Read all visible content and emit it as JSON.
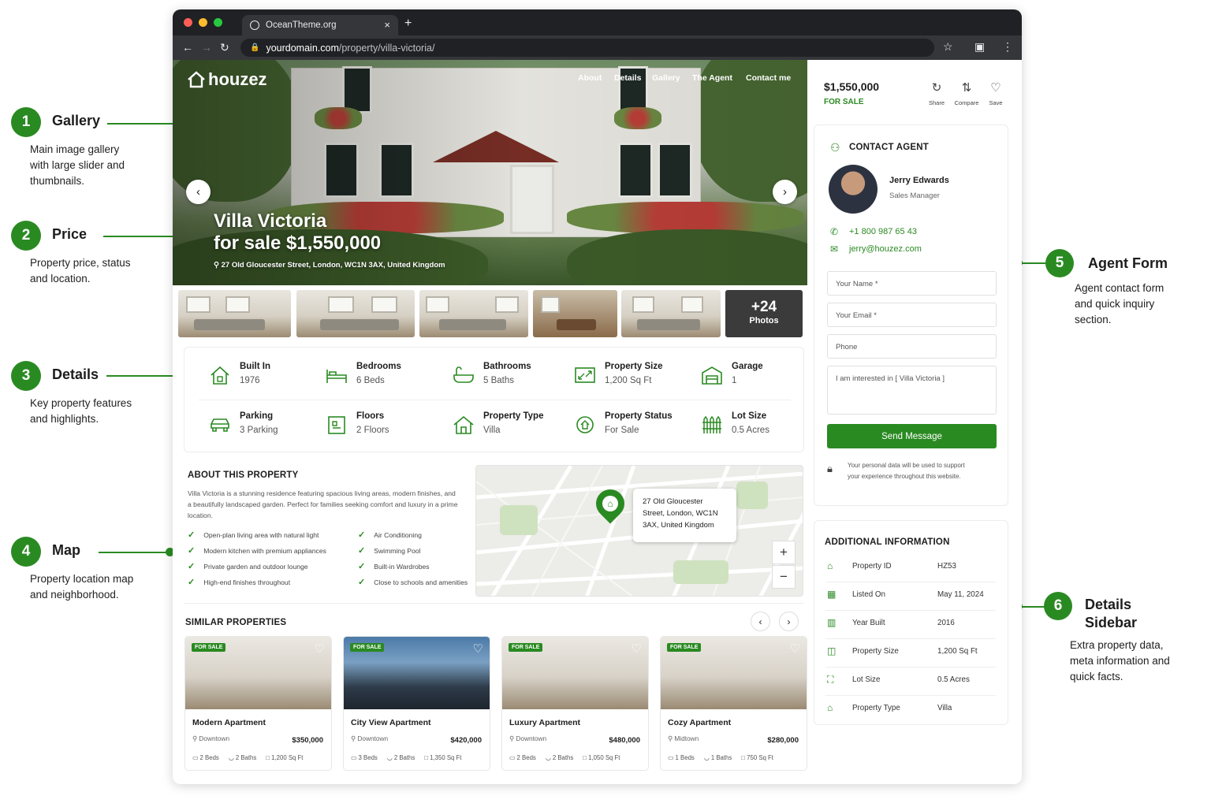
{
  "annotations": [
    {
      "num": "1",
      "title": "Gallery",
      "desc": "Main image gallery with large slider and thumbnails."
    },
    {
      "num": "2",
      "title": "Price",
      "desc": "Property price, status and location."
    },
    {
      "num": "3",
      "title": "Details",
      "desc": "Key property features and highlights."
    },
    {
      "num": "4",
      "title": "Map",
      "desc": "Property location map and neighborhood."
    },
    {
      "num": "5",
      "title": "Agent Form",
      "desc": "Agent contact form and quick inquiry section."
    },
    {
      "num": "6",
      "title": "Details Sidebar",
      "desc": "Extra property data, meta information and quick facts."
    }
  ],
  "browser": {
    "tab_title": "OceanTheme.org",
    "url_domain": "yourdomain.com",
    "url_path": "/property/villa-victoria/"
  },
  "site": {
    "logo": "houzez",
    "menu": [
      "About",
      "Details",
      "Gallery",
      "The Agent",
      "Contact me"
    ],
    "hero_title_line1": "Villa Victoria",
    "hero_title_line2": "for sale $1,550,000",
    "hero_address": "27 Old Gloucester Street, London, WC1N 3AX, United Kingdom",
    "more_photos_count": "+24",
    "more_photos_label": "Photos"
  },
  "details": [
    {
      "label": "Built In",
      "value": "1976",
      "icon": "calendar-house-icon"
    },
    {
      "label": "Bedrooms",
      "value": "6 Beds",
      "icon": "bed-icon"
    },
    {
      "label": "Bathrooms",
      "value": "5 Baths",
      "icon": "bath-icon"
    },
    {
      "label": "Property Size",
      "value": "1,200 Sq Ft",
      "icon": "size-icon"
    },
    {
      "label": "Garage",
      "value": "1",
      "icon": "garage-icon"
    },
    {
      "label": "Parking",
      "value": "3 Parking",
      "icon": "car-icon"
    },
    {
      "label": "Floors",
      "value": "2 Floors",
      "icon": "floors-icon"
    },
    {
      "label": "Property Type",
      "value": "Villa",
      "icon": "home-icon"
    },
    {
      "label": "Property Status",
      "value": "For Sale",
      "icon": "status-icon"
    },
    {
      "label": "Lot Size",
      "value": "0.5 Acres",
      "icon": "fence-icon"
    }
  ],
  "about": {
    "heading": "ABOUT THIS PROPERTY",
    "text": "Villa Victoria is a stunning residence featuring spacious living areas, modern finishes, and a beautifully landscaped garden. Perfect for families seeking comfort and luxury in a prime location.",
    "features_left": [
      "Open-plan living area with natural light",
      "Modern kitchen with premium appliances",
      "Private garden and outdoor lounge",
      "High-end finishes throughout"
    ],
    "features_right": [
      "Air Conditioning",
      "Swimming Pool",
      "Built-in Wardrobes",
      "Close to schools and amenities"
    ]
  },
  "map": {
    "address": "27 Old Gloucester Street, London, WC1N 3AX, United Kingdom",
    "zoom_in": "+",
    "zoom_out": "−"
  },
  "similar": {
    "heading": "SIMILAR PROPERTIES",
    "cards": [
      {
        "badge": "FOR SALE",
        "name": "Modern Apartment",
        "location": "Downtown",
        "price": "$350,000",
        "beds": "2 Beds",
        "baths": "2 Baths",
        "size": "1,200 Sq Ft"
      },
      {
        "badge": "FOR SALE",
        "name": "City View Apartment",
        "location": "Downtown",
        "price": "$420,000",
        "beds": "3 Beds",
        "baths": "2 Baths",
        "size": "1,350 Sq Ft"
      },
      {
        "badge": "FOR SALE",
        "name": "Luxury Apartment",
        "location": "Downtown",
        "price": "$480,000",
        "beds": "2 Beds",
        "baths": "2 Baths",
        "size": "1,050 Sq Ft"
      },
      {
        "badge": "FOR SALE",
        "name": "Cozy Apartment",
        "location": "Midtown",
        "price": "$280,000",
        "beds": "1 Beds",
        "baths": "1 Baths",
        "size": "750 Sq Ft"
      }
    ]
  },
  "sidebar": {
    "price": "$1,550,000",
    "status": "FOR SALE",
    "actions": [
      "Share",
      "Compare",
      "Save"
    ],
    "contact_heading": "CONTACT AGENT",
    "agent_name": "Jerry Edwards",
    "agent_role": "Sales Manager",
    "phone": "+1 800 987 65 43",
    "email": "jerry@houzez.com",
    "name_placeholder": "Your Name *",
    "email_placeholder": "Your Email *",
    "phone_placeholder": "Phone",
    "message": "I am interested in [ Villa Victoria ]",
    "send_label": "Send Message",
    "privacy": "Your personal data will be used to support your experience throughout this website.",
    "info_heading": "ADDITIONAL INFORMATION",
    "info": [
      {
        "key": "Property ID",
        "value": "HZ53",
        "icon": "tag-icon"
      },
      {
        "key": "Listed On",
        "value": "May 11, 2024",
        "icon": "calendar-icon"
      },
      {
        "key": "Year Built",
        "value": "2016",
        "icon": "building-icon"
      },
      {
        "key": "Property Size",
        "value": "1,200 Sq Ft",
        "icon": "size-icon"
      },
      {
        "key": "Lot Size",
        "value": "0.5 Acres",
        "icon": "lot-icon"
      },
      {
        "key": "Property Type",
        "value": "Villa",
        "icon": "home-icon"
      }
    ]
  },
  "colors": {
    "accent": "#2a8a22"
  }
}
